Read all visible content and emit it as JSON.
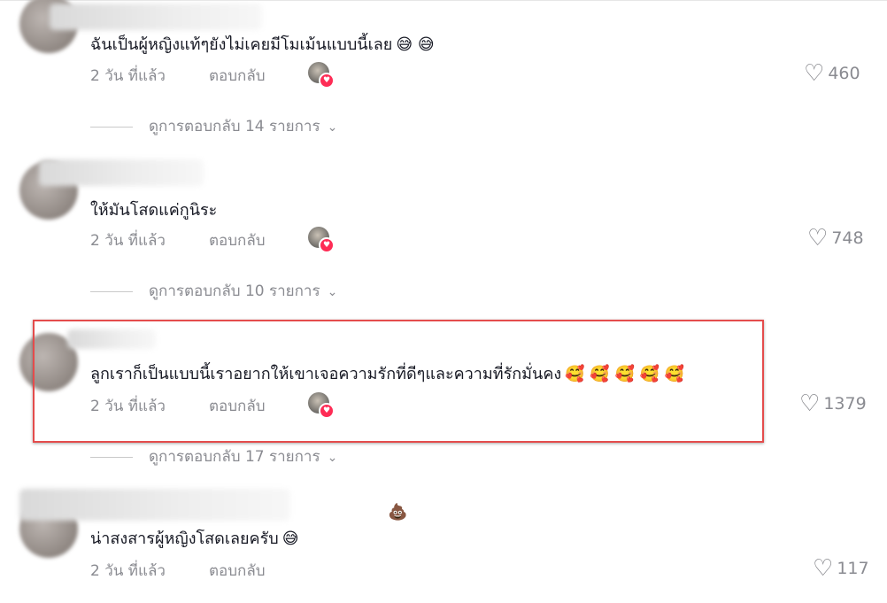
{
  "comments": [
    {
      "text": "ฉันเป็นผู้หญิงแท้ๆยังไม่เคยมีโมเม้นแบบนี้เลย",
      "emojis": "😅 😅",
      "time": "2 วัน ที่แล้ว",
      "reply": "ตอบกลับ",
      "likes": "460",
      "view_replies": "ดูการตอบกลับ 14 รายการ"
    },
    {
      "text": "ให้มันโสดแค่กูนิระ",
      "emojis": "",
      "time": "2 วัน ที่แล้ว",
      "reply": "ตอบกลับ",
      "likes": "748",
      "view_replies": "ดูการตอบกลับ 10 รายการ"
    },
    {
      "text": "ลูกเราก็เป็นแบบนี้เราอยากให้เขาเจอความรักที่ดีๆและความที่รักมั่นคง",
      "emojis": "🥰 🥰 🥰 🥰 🥰",
      "time": "2 วัน ที่แล้ว",
      "reply": "ตอบกลับ",
      "likes": "1379",
      "view_replies": "ดูการตอบกลับ 17 รายการ"
    },
    {
      "text": "น่าสงสารผู้หญิงโสดเลยครับ",
      "emojis": "😅",
      "time": "2 วัน ที่แล้ว",
      "reply": "ตอบกลับ",
      "likes": "117",
      "view_replies": ""
    }
  ],
  "icons": {
    "like": "heart-outline-icon",
    "chevron": "chevron-down-icon",
    "creator_liked": "creator-heart-badge"
  },
  "colors": {
    "highlight_border": "#e44c4c",
    "creator_heart": "#fe2c55",
    "meta_text": "#8a8b91"
  }
}
